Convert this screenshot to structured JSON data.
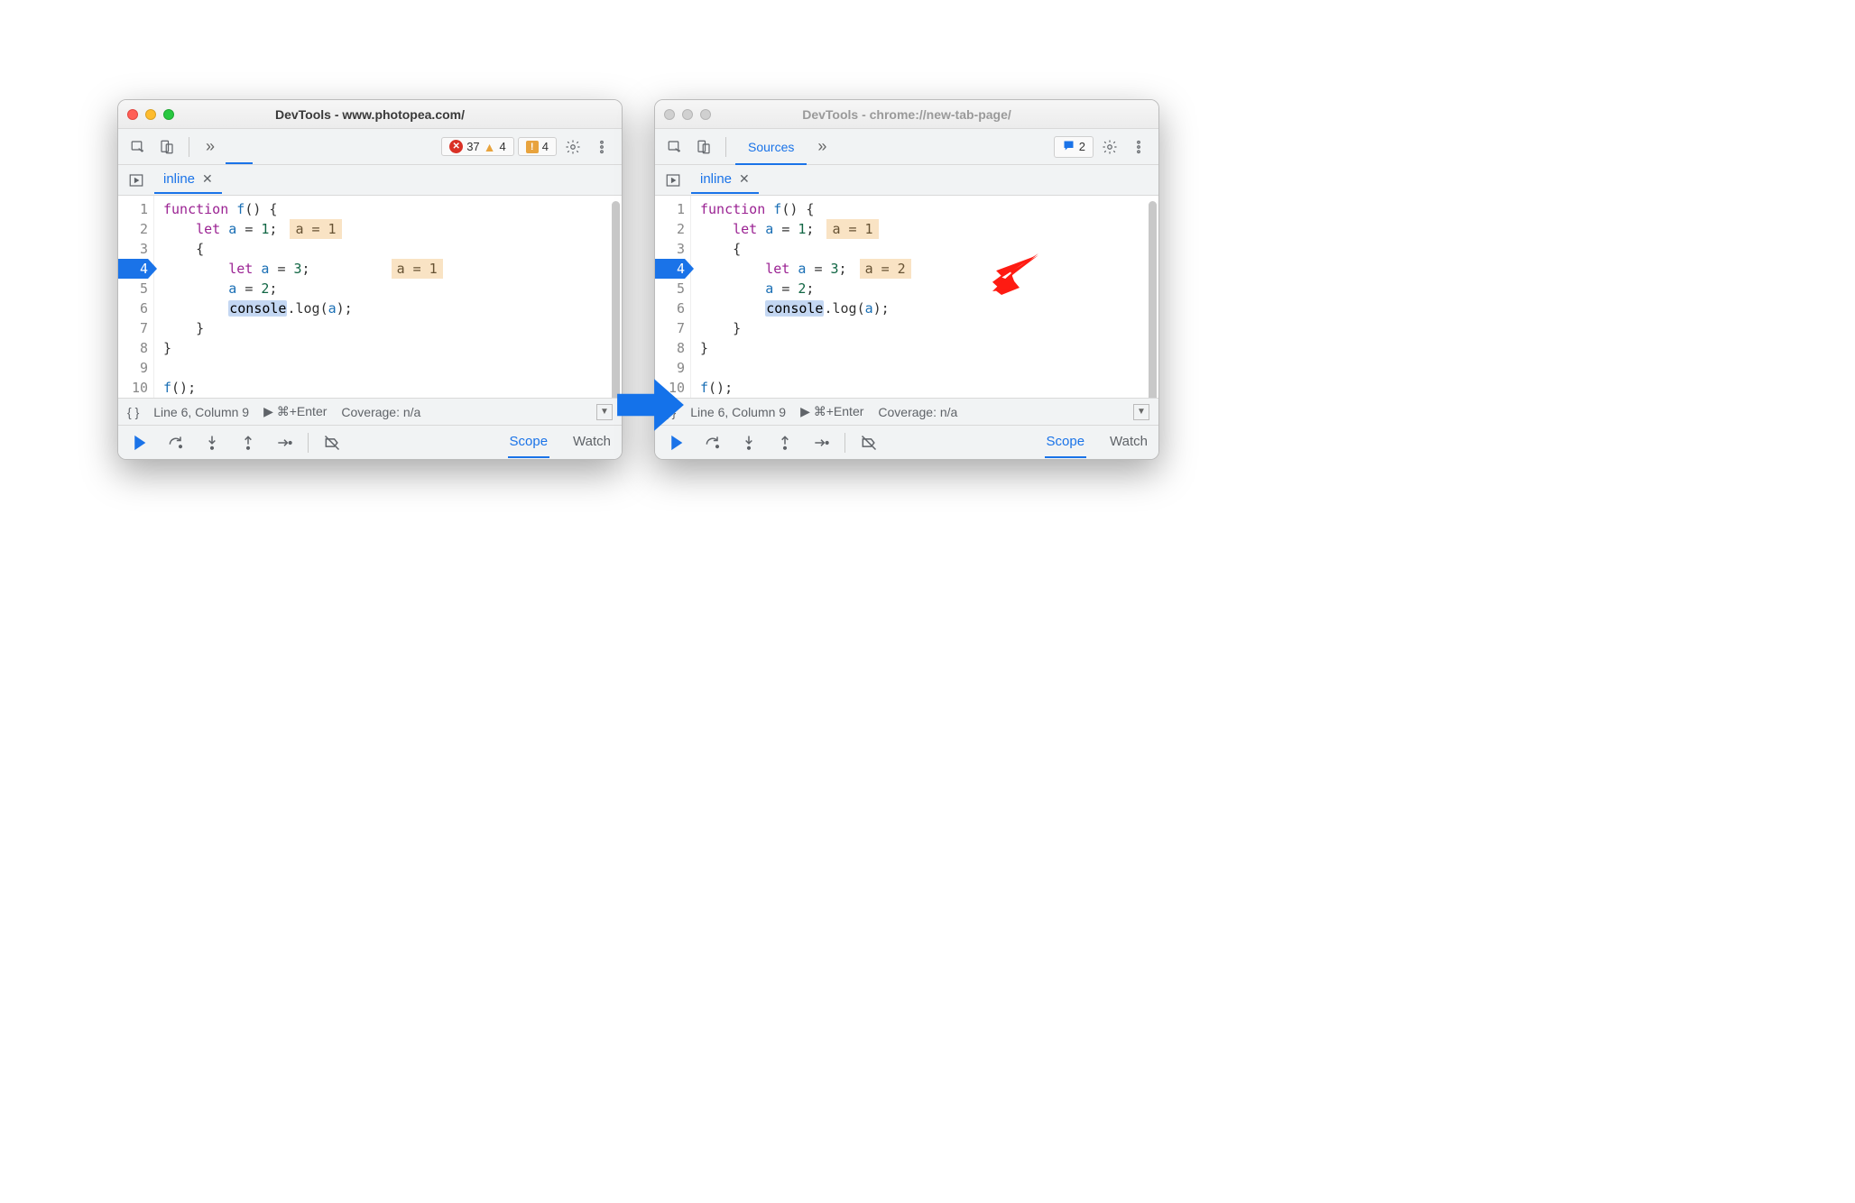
{
  "arrow_color": "#1472ea",
  "red_arrow_color": "#fe1b12",
  "windows": {
    "left": {
      "active": true,
      "title": "DevTools - www.photopea.com/",
      "toolbar": {
        "errors": "37",
        "warnings1": "4",
        "warnings2": "4"
      },
      "file_tab": "inline",
      "code": {
        "lines": [
          "function f() {",
          "    let a = 1;",
          "    {",
          "        let a = 3;",
          "        a = 2;",
          "        console.log(a);",
          "    }",
          "}",
          "",
          "f();"
        ],
        "hints": {
          "2": "a = 1",
          "4": "a = 1"
        },
        "exec_line": 4,
        "highlight_line": 6,
        "selected_token_line6": "console"
      },
      "status": {
        "braces": "{ }",
        "pos": "Line 6, Column 9",
        "run": "▶ ⌘+Enter",
        "coverage": "Coverage: n/a"
      },
      "debug_tabs": {
        "scope": "Scope",
        "watch": "Watch",
        "active": "scope"
      }
    },
    "right": {
      "active": false,
      "title": "DevTools - chrome://new-tab-page/",
      "toolbar": {
        "sources_label": "Sources",
        "messages": "2"
      },
      "file_tab": "inline",
      "code": {
        "lines": [
          "function f() {",
          "    let a = 1;",
          "    {",
          "        let a = 3;",
          "        a = 2;",
          "        console.log(a);",
          "    }",
          "}",
          "",
          "f();"
        ],
        "hints": {
          "2": "a = 1",
          "4": "a = 2"
        },
        "exec_line": 4,
        "highlight_line": 6,
        "selected_token_line6": "console"
      },
      "status": {
        "braces": "{ }",
        "pos": "Line 6, Column 9",
        "run": "▶ ⌘+Enter",
        "coverage": "Coverage: n/a"
      },
      "debug_tabs": {
        "scope": "Scope",
        "watch": "Watch",
        "active": "scope"
      }
    }
  }
}
